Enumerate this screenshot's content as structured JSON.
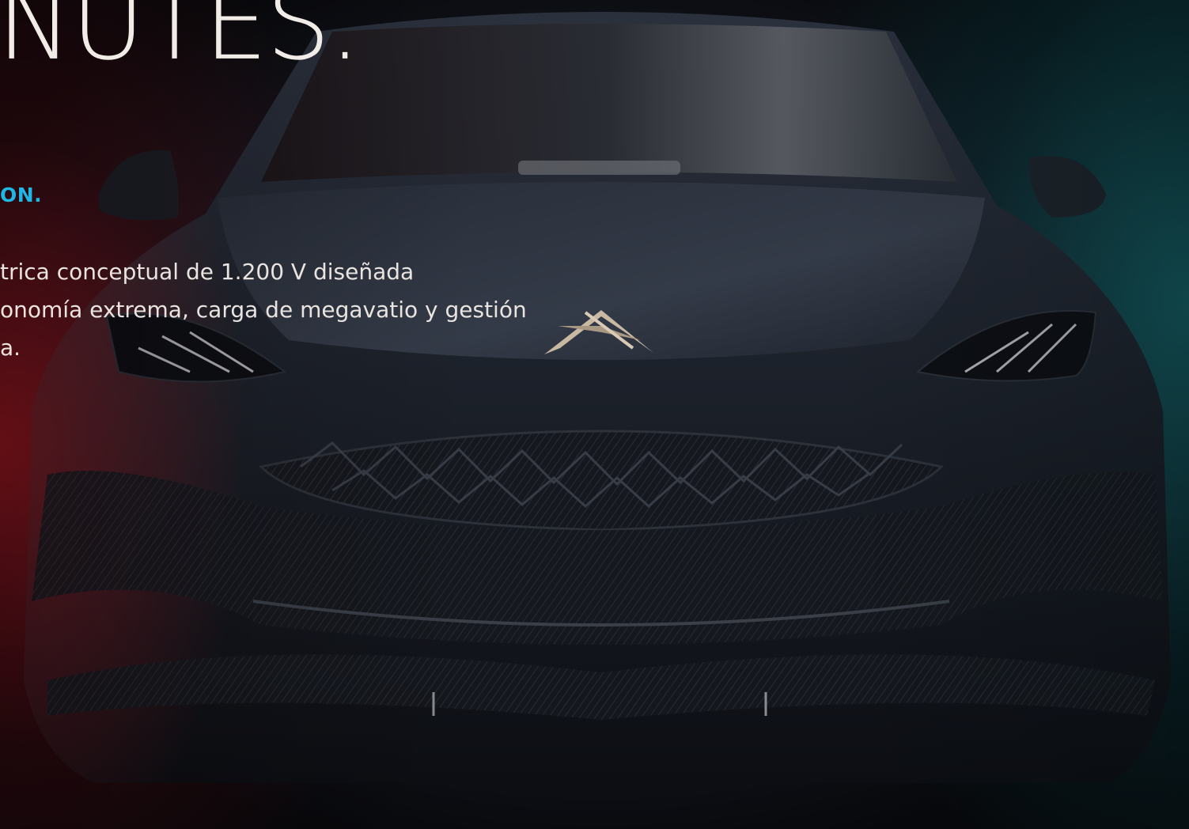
{
  "hero": {
    "headline": "NUTES.",
    "subheading": "ON.",
    "description_lines": [
      "trica conceptual de 1.200 V diseñada",
      "onomía extrema, carga de megavatio y gestión",
      "a."
    ],
    "image": {
      "subject": "dark concept electric car front view with carbon fiber grille",
      "emblem-icon": "brand-emblem-icon"
    }
  },
  "colors": {
    "accent": "#1fb8e6",
    "headline": "#f2ece8",
    "body_text": "#e9e4e0",
    "left_glow": "#961420",
    "right_glow": "#145f64",
    "car_body": "#1c212b"
  }
}
